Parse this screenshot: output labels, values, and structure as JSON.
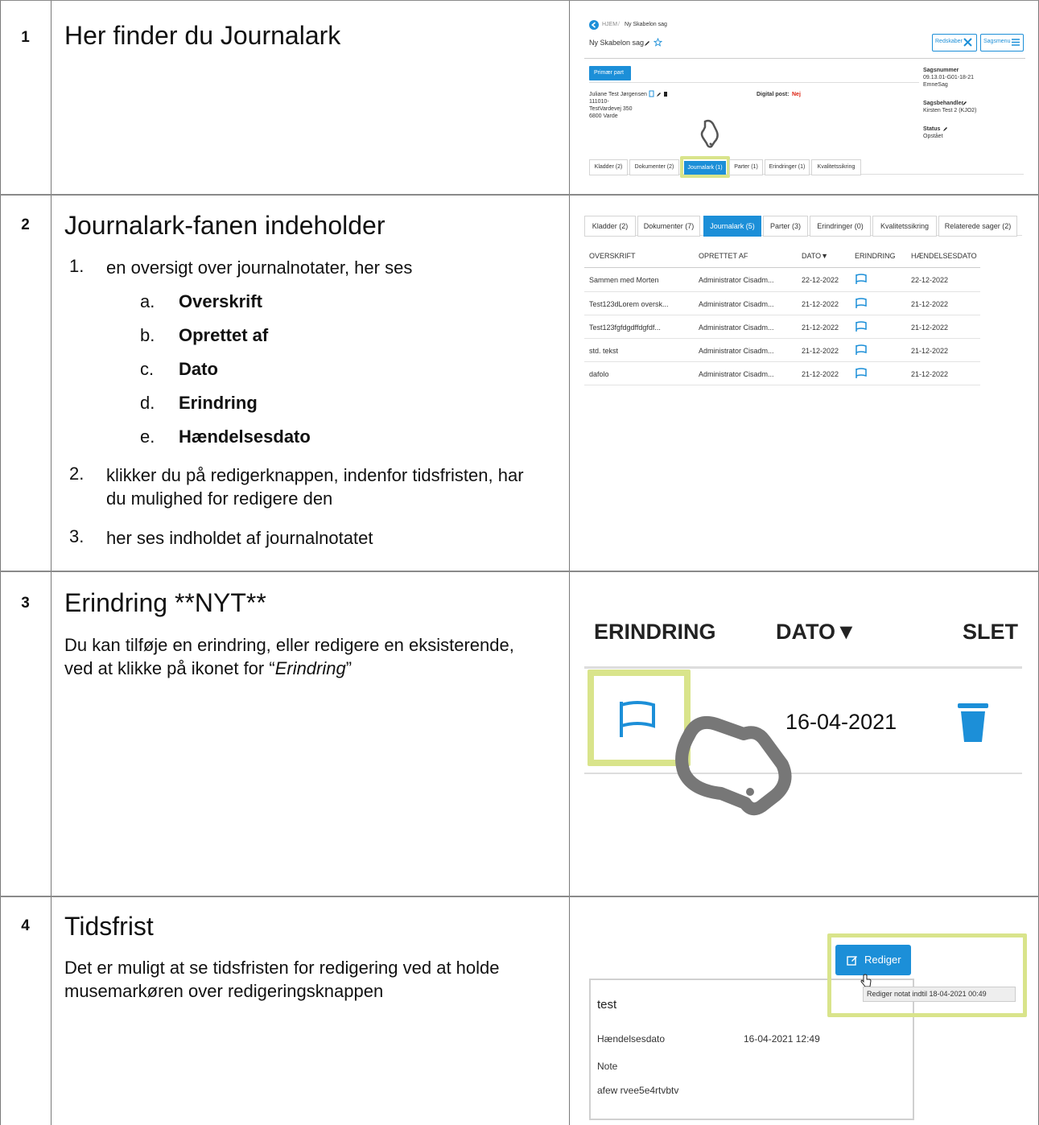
{
  "steps": [
    {
      "num": "1",
      "heading": "Her finder du Journalark"
    },
    {
      "num": "2",
      "heading": "Journalark-fanen indeholder",
      "list": [
        {
          "n": "1.",
          "text": "en oversigt over journalnotater, her ses",
          "sub": [
            {
              "n": "a.",
              "text": "Overskrift"
            },
            {
              "n": "b.",
              "text": "Oprettet af"
            },
            {
              "n": "c.",
              "text": "Dato"
            },
            {
              "n": "d.",
              "text": "Erindring"
            },
            {
              "n": "e.",
              "text": "Hændelsesdato"
            }
          ]
        },
        {
          "n": "2.",
          "text": "klikker du på redigerknappen, indenfor tidsfristen, har du mulighed for redigere den"
        },
        {
          "n": "3.",
          "text": "her ses indholdet af journalnotatet"
        }
      ]
    },
    {
      "num": "3",
      "heading": "Erindring **NYT**",
      "para_start": "Du kan tilføje en erindring, eller redigere en eksisterende, ved at klikke på ikonet for “",
      "para_em": "Erindring",
      "para_end": "”"
    },
    {
      "num": "4",
      "heading": "Tidsfrist",
      "para": "Det er muligt at se tidsfristen for redigering ved at holde musemarkøren over redigeringsknappen"
    }
  ],
  "shot1": {
    "breadcrumb_home": "HJEM",
    "breadcrumb_sep": "/",
    "breadcrumb_case": "Ny Skabelon sag",
    "case_title": "Ny Skabelon sag",
    "btn_tools": "Redskaber",
    "btn_menu": "Sagsmenu",
    "primary_party": "Primær part",
    "party_name": "Juliane Test Jørgensen",
    "party_cpr": "111010-",
    "party_street": "TestVardevej 350",
    "party_city": "6800 Varde",
    "digital_post_label": "Digital post:",
    "digital_post_value": "Nej",
    "sagsnummer_label": "Sagsnummer",
    "sagsnummer_value": "09.13.01-G01-18-21",
    "emnesag": "EmneSag",
    "sagsbehandler_label": "Sagsbehandler",
    "sagsbehandler_value": "Kirsten Test 2 (KJO2)",
    "status_label": "Status",
    "status_value": "Opstået",
    "tabs": [
      "Kladder (2)",
      "Dokumenter (2)",
      "Journalark (1)",
      "Parter (1)",
      "Erindringer (1)",
      "Kvalitetssikring"
    ],
    "accent": "#1c8fd8"
  },
  "shot2": {
    "tabs": [
      "Kladder (2)",
      "Dokumenter (7)",
      "Journalark (5)",
      "Parter (3)",
      "Erindringer (0)",
      "Kvalitetssikring",
      "Relaterede sager (2)"
    ],
    "columns": [
      "OVERSKRIFT",
      "OPRETTET AF",
      "DATO▼",
      "ERINDRING",
      "HÆNDELSESDATO"
    ],
    "rows": [
      [
        "Sammen med Morten",
        "Administrator Cisadm...",
        "22-12-2022",
        "",
        "22-12-2022"
      ],
      [
        "Test123dLorem oversk...",
        "Administrator Cisadm...",
        "21-12-2022",
        "",
        "21-12-2022"
      ],
      [
        "Test123fgfdgdffdgfdf...",
        "Administrator Cisadm...",
        "21-12-2022",
        "",
        "21-12-2022"
      ],
      [
        "std. tekst",
        "Administrator Cisadm...",
        "21-12-2022",
        "",
        "21-12-2022"
      ],
      [
        "dafolo",
        "Administrator Cisadm...",
        "21-12-2022",
        "",
        "21-12-2022"
      ]
    ]
  },
  "shot3": {
    "col_erindring": "ERINDRING",
    "col_dato": "DATO▼",
    "col_slet": "SLET",
    "date": "16-04-2021",
    "flag_color": "#1c8fd8",
    "trash_color": "#1c8fd8",
    "highlight_color": "#d9e48b"
  },
  "shot4": {
    "btn_label": "Rediger",
    "tooltip": "Rediger notat indtil 18-04-2021 00:49",
    "card_title": "test",
    "label_date": "Hændelsesdato",
    "value_date": "16-04-2021 12:49",
    "label_note": "Note",
    "value_note": "afew rvee5e4rtvbtv"
  }
}
